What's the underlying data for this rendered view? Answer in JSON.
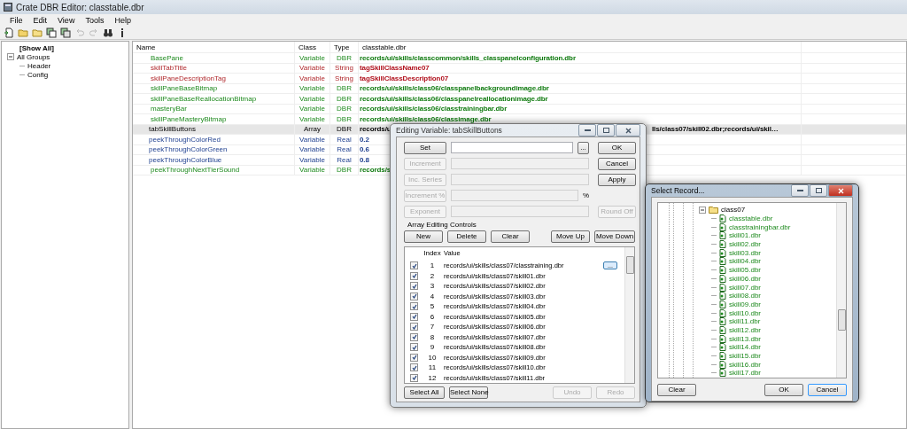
{
  "window": {
    "title": "Crate DBR Editor: classtable.dbr"
  },
  "menu": [
    "File",
    "Edit",
    "View",
    "Tools",
    "Help"
  ],
  "toolbar": [
    {
      "kind": "new",
      "disabled": false
    },
    {
      "kind": "open",
      "disabled": false
    },
    {
      "kind": "folder",
      "disabled": false
    },
    {
      "kind": "copy",
      "disabled": false
    },
    {
      "kind": "paste",
      "disabled": false
    },
    {
      "kind": "undo",
      "disabled": true
    },
    {
      "kind": "redo",
      "disabled": true
    },
    {
      "kind": "find",
      "disabled": false
    },
    {
      "kind": "info",
      "disabled": false
    }
  ],
  "groups": {
    "show_all": "[Show All]",
    "tree": [
      {
        "label": "All Groups",
        "expanded": true,
        "children": [
          {
            "label": "Header"
          },
          {
            "label": "Config"
          }
        ]
      }
    ]
  },
  "table": {
    "columns": [
      "Name",
      "Class",
      "Type",
      "classtable.dbr"
    ],
    "rows": [
      {
        "name": "BasePane",
        "class": "Variable",
        "type": "DBR",
        "value": "records/ui/skills/classcommon/skills_classpanelconfiguration.dbr",
        "kind": "dbr",
        "selected": false
      },
      {
        "name": "skillTabTitle",
        "class": "Variable",
        "type": "String",
        "value": "tagSkillClassName07",
        "kind": "string",
        "selected": false
      },
      {
        "name": "skillPaneDescriptionTag",
        "class": "Variable",
        "type": "String",
        "value": "tagSkillClassDescription07",
        "kind": "string",
        "selected": false
      },
      {
        "name": "skillPaneBaseBitmap",
        "class": "Variable",
        "type": "DBR",
        "value": "records/ui/skills/class06/classpanelbackgroundimage.dbr",
        "kind": "dbr",
        "selected": false
      },
      {
        "name": "skillPaneBaseReallocationBitmap",
        "class": "Variable",
        "type": "DBR",
        "value": "records/ui/skills/class06/classpanelreallocationimage.dbr",
        "kind": "dbr",
        "selected": false
      },
      {
        "name": "masteryBar",
        "class": "Variable",
        "type": "DBR",
        "value": "records/ui/skills/class06/classtrainingbar.dbr",
        "kind": "dbr",
        "selected": false
      },
      {
        "name": "skillPaneMasteryBitmap",
        "class": "Variable",
        "type": "DBR",
        "value": "records/ui/skills/class06/classimage.dbr",
        "kind": "dbr",
        "selected": false
      },
      {
        "name": "tabSkillButtons",
        "class": "Array",
        "type": "DBR",
        "value": "records/u",
        "value_tail": "lls/class07/skill02.dbr;records/ui/skil…",
        "kind": "array",
        "selected": true
      },
      {
        "name": "peekThroughColorRed",
        "class": "Variable",
        "type": "Real",
        "value": "0.2",
        "kind": "real",
        "selected": false
      },
      {
        "name": "peekThroughColorGreen",
        "class": "Variable",
        "type": "Real",
        "value": "0.6",
        "kind": "real",
        "selected": false
      },
      {
        "name": "peekThroughColorBlue",
        "class": "Variable",
        "type": "Real",
        "value": "0.8",
        "kind": "real",
        "selected": false
      },
      {
        "name": "peekThroughNextTierSound",
        "class": "Variable",
        "type": "DBR",
        "value": "records/s",
        "kind": "dbr",
        "selected": false
      }
    ]
  },
  "edit_dialog": {
    "title": "Editing Variable: tabSkillButtons",
    "active": false,
    "rows": [
      {
        "button": "Set",
        "disabled": false,
        "browse": "...",
        "side": "OK",
        "side_disabled": false
      },
      {
        "button": "Increment",
        "disabled": true,
        "side": "Cancel",
        "side_disabled": false
      },
      {
        "button": "Inc. Series",
        "disabled": true,
        "side": "Apply",
        "side_disabled": false
      },
      {
        "button": "Increment %",
        "disabled": true,
        "unit": "%"
      },
      {
        "button": "Exponent",
        "disabled": true,
        "side": "Round Off",
        "side_disabled": true
      }
    ],
    "array_label": "Array Editing Controls",
    "array_buttons": [
      "New",
      "Delete",
      "Clear",
      "Move Up",
      "Move Down"
    ],
    "list_columns": [
      "Index",
      "Value"
    ],
    "items": [
      {
        "index": "1",
        "value": "records/ui/skills/class07/classtraining.dbr",
        "checked": true,
        "browse": "..."
      },
      {
        "index": "2",
        "value": "records/ui/skills/class07/skill01.dbr",
        "checked": true
      },
      {
        "index": "3",
        "value": "records/ui/skills/class07/skill02.dbr",
        "checked": true
      },
      {
        "index": "4",
        "value": "records/ui/skills/class07/skill03.dbr",
        "checked": true
      },
      {
        "index": "5",
        "value": "records/ui/skills/class07/skill04.dbr",
        "checked": true
      },
      {
        "index": "6",
        "value": "records/ui/skills/class07/skill05.dbr",
        "checked": true
      },
      {
        "index": "7",
        "value": "records/ui/skills/class07/skill06.dbr",
        "checked": true
      },
      {
        "index": "8",
        "value": "records/ui/skills/class07/skill07.dbr",
        "checked": true
      },
      {
        "index": "9",
        "value": "records/ui/skills/class07/skill08.dbr",
        "checked": true
      },
      {
        "index": "10",
        "value": "records/ui/skills/class07/skill09.dbr",
        "checked": true
      },
      {
        "index": "11",
        "value": "records/ui/skills/class07/skill10.dbr",
        "checked": true
      },
      {
        "index": "12",
        "value": "records/ui/skills/class07/skill11.dbr",
        "checked": true
      }
    ],
    "bottom_buttons": [
      {
        "label": "Select All",
        "disabled": false
      },
      {
        "label": "Select None",
        "disabled": false
      },
      {
        "label": "Undo",
        "disabled": true
      },
      {
        "label": "Redo",
        "disabled": true
      }
    ]
  },
  "record_dialog": {
    "title": "Select Record...",
    "active": true,
    "tree": [
      {
        "label": "class07",
        "expanded": true,
        "children": [
          {
            "label": "classtable.dbr"
          },
          {
            "label": "classtrainingbar.dbr"
          },
          {
            "label": "skill01.dbr"
          },
          {
            "label": "skill02.dbr"
          },
          {
            "label": "skill03.dbr"
          },
          {
            "label": "skill04.dbr"
          },
          {
            "label": "skill05.dbr"
          },
          {
            "label": "skill06.dbr"
          },
          {
            "label": "skill07.dbr"
          },
          {
            "label": "skill08.dbr"
          },
          {
            "label": "skill09.dbr"
          },
          {
            "label": "skill10.dbr"
          },
          {
            "label": "skill11.dbr"
          },
          {
            "label": "skill12.dbr"
          },
          {
            "label": "skill13.dbr"
          },
          {
            "label": "skill14.dbr"
          },
          {
            "label": "skill15.dbr"
          },
          {
            "label": "skill16.dbr"
          },
          {
            "label": "skill17.dbr"
          }
        ]
      }
    ],
    "buttons": [
      {
        "label": "Clear",
        "focused": false
      },
      {
        "label": "OK",
        "focused": false
      },
      {
        "label": "Cancel",
        "focused": true
      }
    ]
  }
}
